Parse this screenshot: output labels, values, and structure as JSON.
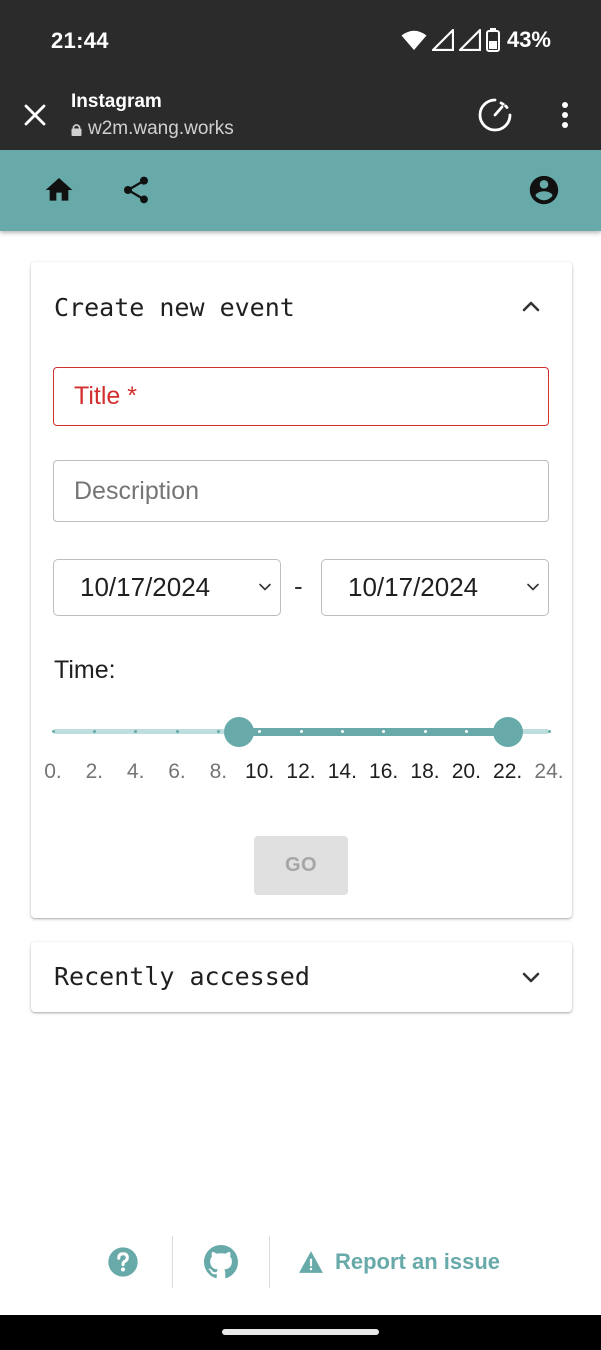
{
  "status_bar": {
    "time": "21:44",
    "battery": "43%"
  },
  "browser": {
    "title": "Instagram",
    "url": "w2m.wang.works"
  },
  "colors": {
    "accent": "#67aaa9",
    "error": "#d32f2f",
    "rail": "#bddedd"
  },
  "create_event": {
    "heading": "Create new event",
    "title_placeholder": "Title *",
    "description_placeholder": "Description",
    "start_date": "10/17/2024",
    "end_date": "10/17/2024",
    "date_separator": "-",
    "time_label": "Time:",
    "time_range": {
      "min": 0,
      "max": 24,
      "step": 2,
      "start": 9,
      "end": 22
    },
    "tick_labels": [
      "0.",
      "2.",
      "4.",
      "6.",
      "8.",
      "10.",
      "12.",
      "14.",
      "16.",
      "18.",
      "20.",
      "22.",
      "24."
    ],
    "go_label": "GO"
  },
  "recent": {
    "heading": "Recently accessed"
  },
  "footer": {
    "report_label": "Report an issue"
  }
}
